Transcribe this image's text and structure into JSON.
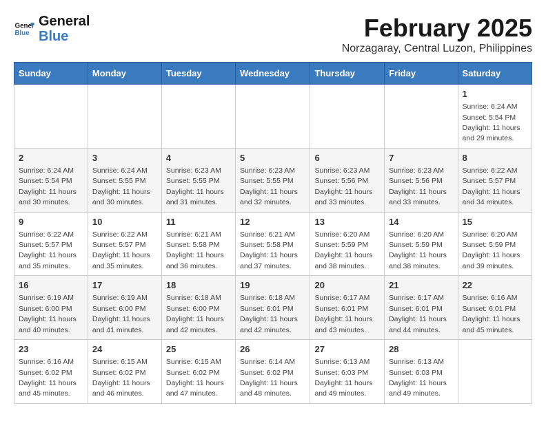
{
  "header": {
    "logo_line1": "General",
    "logo_line2": "Blue",
    "month_year": "February 2025",
    "location": "Norzagaray, Central Luzon, Philippines"
  },
  "days_of_week": [
    "Sunday",
    "Monday",
    "Tuesday",
    "Wednesday",
    "Thursday",
    "Friday",
    "Saturday"
  ],
  "weeks": [
    [
      {
        "day": "",
        "info": ""
      },
      {
        "day": "",
        "info": ""
      },
      {
        "day": "",
        "info": ""
      },
      {
        "day": "",
        "info": ""
      },
      {
        "day": "",
        "info": ""
      },
      {
        "day": "",
        "info": ""
      },
      {
        "day": "1",
        "info": "Sunrise: 6:24 AM\nSunset: 5:54 PM\nDaylight: 11 hours and 29 minutes."
      }
    ],
    [
      {
        "day": "2",
        "info": "Sunrise: 6:24 AM\nSunset: 5:54 PM\nDaylight: 11 hours and 30 minutes."
      },
      {
        "day": "3",
        "info": "Sunrise: 6:24 AM\nSunset: 5:55 PM\nDaylight: 11 hours and 30 minutes."
      },
      {
        "day": "4",
        "info": "Sunrise: 6:23 AM\nSunset: 5:55 PM\nDaylight: 11 hours and 31 minutes."
      },
      {
        "day": "5",
        "info": "Sunrise: 6:23 AM\nSunset: 5:55 PM\nDaylight: 11 hours and 32 minutes."
      },
      {
        "day": "6",
        "info": "Sunrise: 6:23 AM\nSunset: 5:56 PM\nDaylight: 11 hours and 33 minutes."
      },
      {
        "day": "7",
        "info": "Sunrise: 6:23 AM\nSunset: 5:56 PM\nDaylight: 11 hours and 33 minutes."
      },
      {
        "day": "8",
        "info": "Sunrise: 6:22 AM\nSunset: 5:57 PM\nDaylight: 11 hours and 34 minutes."
      }
    ],
    [
      {
        "day": "9",
        "info": "Sunrise: 6:22 AM\nSunset: 5:57 PM\nDaylight: 11 hours and 35 minutes."
      },
      {
        "day": "10",
        "info": "Sunrise: 6:22 AM\nSunset: 5:57 PM\nDaylight: 11 hours and 35 minutes."
      },
      {
        "day": "11",
        "info": "Sunrise: 6:21 AM\nSunset: 5:58 PM\nDaylight: 11 hours and 36 minutes."
      },
      {
        "day": "12",
        "info": "Sunrise: 6:21 AM\nSunset: 5:58 PM\nDaylight: 11 hours and 37 minutes."
      },
      {
        "day": "13",
        "info": "Sunrise: 6:20 AM\nSunset: 5:59 PM\nDaylight: 11 hours and 38 minutes."
      },
      {
        "day": "14",
        "info": "Sunrise: 6:20 AM\nSunset: 5:59 PM\nDaylight: 11 hours and 38 minutes."
      },
      {
        "day": "15",
        "info": "Sunrise: 6:20 AM\nSunset: 5:59 PM\nDaylight: 11 hours and 39 minutes."
      }
    ],
    [
      {
        "day": "16",
        "info": "Sunrise: 6:19 AM\nSunset: 6:00 PM\nDaylight: 11 hours and 40 minutes."
      },
      {
        "day": "17",
        "info": "Sunrise: 6:19 AM\nSunset: 6:00 PM\nDaylight: 11 hours and 41 minutes."
      },
      {
        "day": "18",
        "info": "Sunrise: 6:18 AM\nSunset: 6:00 PM\nDaylight: 11 hours and 42 minutes."
      },
      {
        "day": "19",
        "info": "Sunrise: 6:18 AM\nSunset: 6:01 PM\nDaylight: 11 hours and 42 minutes."
      },
      {
        "day": "20",
        "info": "Sunrise: 6:17 AM\nSunset: 6:01 PM\nDaylight: 11 hours and 43 minutes."
      },
      {
        "day": "21",
        "info": "Sunrise: 6:17 AM\nSunset: 6:01 PM\nDaylight: 11 hours and 44 minutes."
      },
      {
        "day": "22",
        "info": "Sunrise: 6:16 AM\nSunset: 6:01 PM\nDaylight: 11 hours and 45 minutes."
      }
    ],
    [
      {
        "day": "23",
        "info": "Sunrise: 6:16 AM\nSunset: 6:02 PM\nDaylight: 11 hours and 45 minutes."
      },
      {
        "day": "24",
        "info": "Sunrise: 6:15 AM\nSunset: 6:02 PM\nDaylight: 11 hours and 46 minutes."
      },
      {
        "day": "25",
        "info": "Sunrise: 6:15 AM\nSunset: 6:02 PM\nDaylight: 11 hours and 47 minutes."
      },
      {
        "day": "26",
        "info": "Sunrise: 6:14 AM\nSunset: 6:02 PM\nDaylight: 11 hours and 48 minutes."
      },
      {
        "day": "27",
        "info": "Sunrise: 6:13 AM\nSunset: 6:03 PM\nDaylight: 11 hours and 49 minutes."
      },
      {
        "day": "28",
        "info": "Sunrise: 6:13 AM\nSunset: 6:03 PM\nDaylight: 11 hours and 49 minutes."
      },
      {
        "day": "",
        "info": ""
      }
    ]
  ]
}
